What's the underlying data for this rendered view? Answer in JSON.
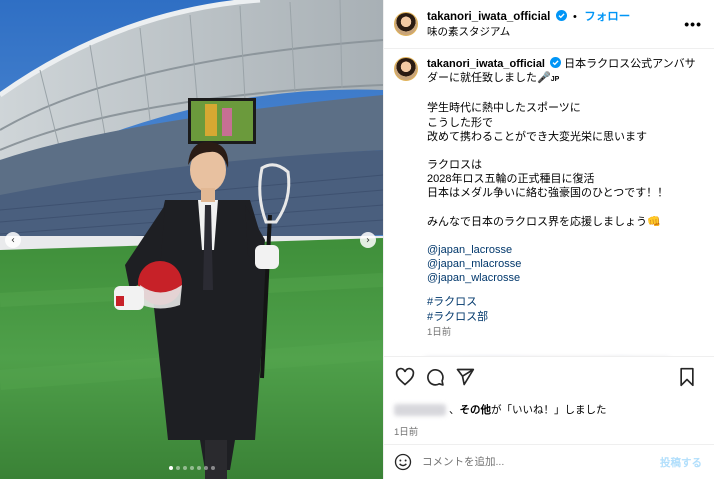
{
  "header": {
    "username": "takanori_iwata_official",
    "separator": "•",
    "follow_label": "フォロー",
    "location": "味の素スタジアム",
    "more_label": "•••"
  },
  "caption": {
    "username": "takanori_iwata_official",
    "first_line": "日本ラクロス公式アンバサダーに就任致しました🎤",
    "flag_code": "JP",
    "para1": [
      "学生時代に熱中したスポーツに",
      "こうした形で",
      "改めて携わることができ大変光栄に思います"
    ],
    "para2": [
      "ラクロスは",
      "2028年ロス五輪の正式種目に復活",
      "日本はメダル争いに絡む強豪国のひとつです！！"
    ],
    "para3": "みんなで日本のラクロス界を応援しましょう👊",
    "mentions": [
      "@japan_lacrosse",
      "@japan_mlacrosse",
      "@japan_wlacrosse"
    ],
    "hashtags": [
      "#ラクロス",
      "#ラクロス部"
    ],
    "time": "1日前"
  },
  "likes": {
    "others_label": "その他",
    "text_suffix": "が「いいね！」しました",
    "comma": "、"
  },
  "date": "1日前",
  "comment": {
    "placeholder": "コメントを追加...",
    "post_label": "投稿する"
  },
  "carousel": {
    "slide_count": 7,
    "active_index": 0,
    "prev_icon": "chevron-left-icon",
    "next_icon": "chevron-right-icon"
  },
  "colors": {
    "link": "#00376b",
    "follow": "#0095f6",
    "verified": "#0095f6",
    "muted": "#737373"
  }
}
